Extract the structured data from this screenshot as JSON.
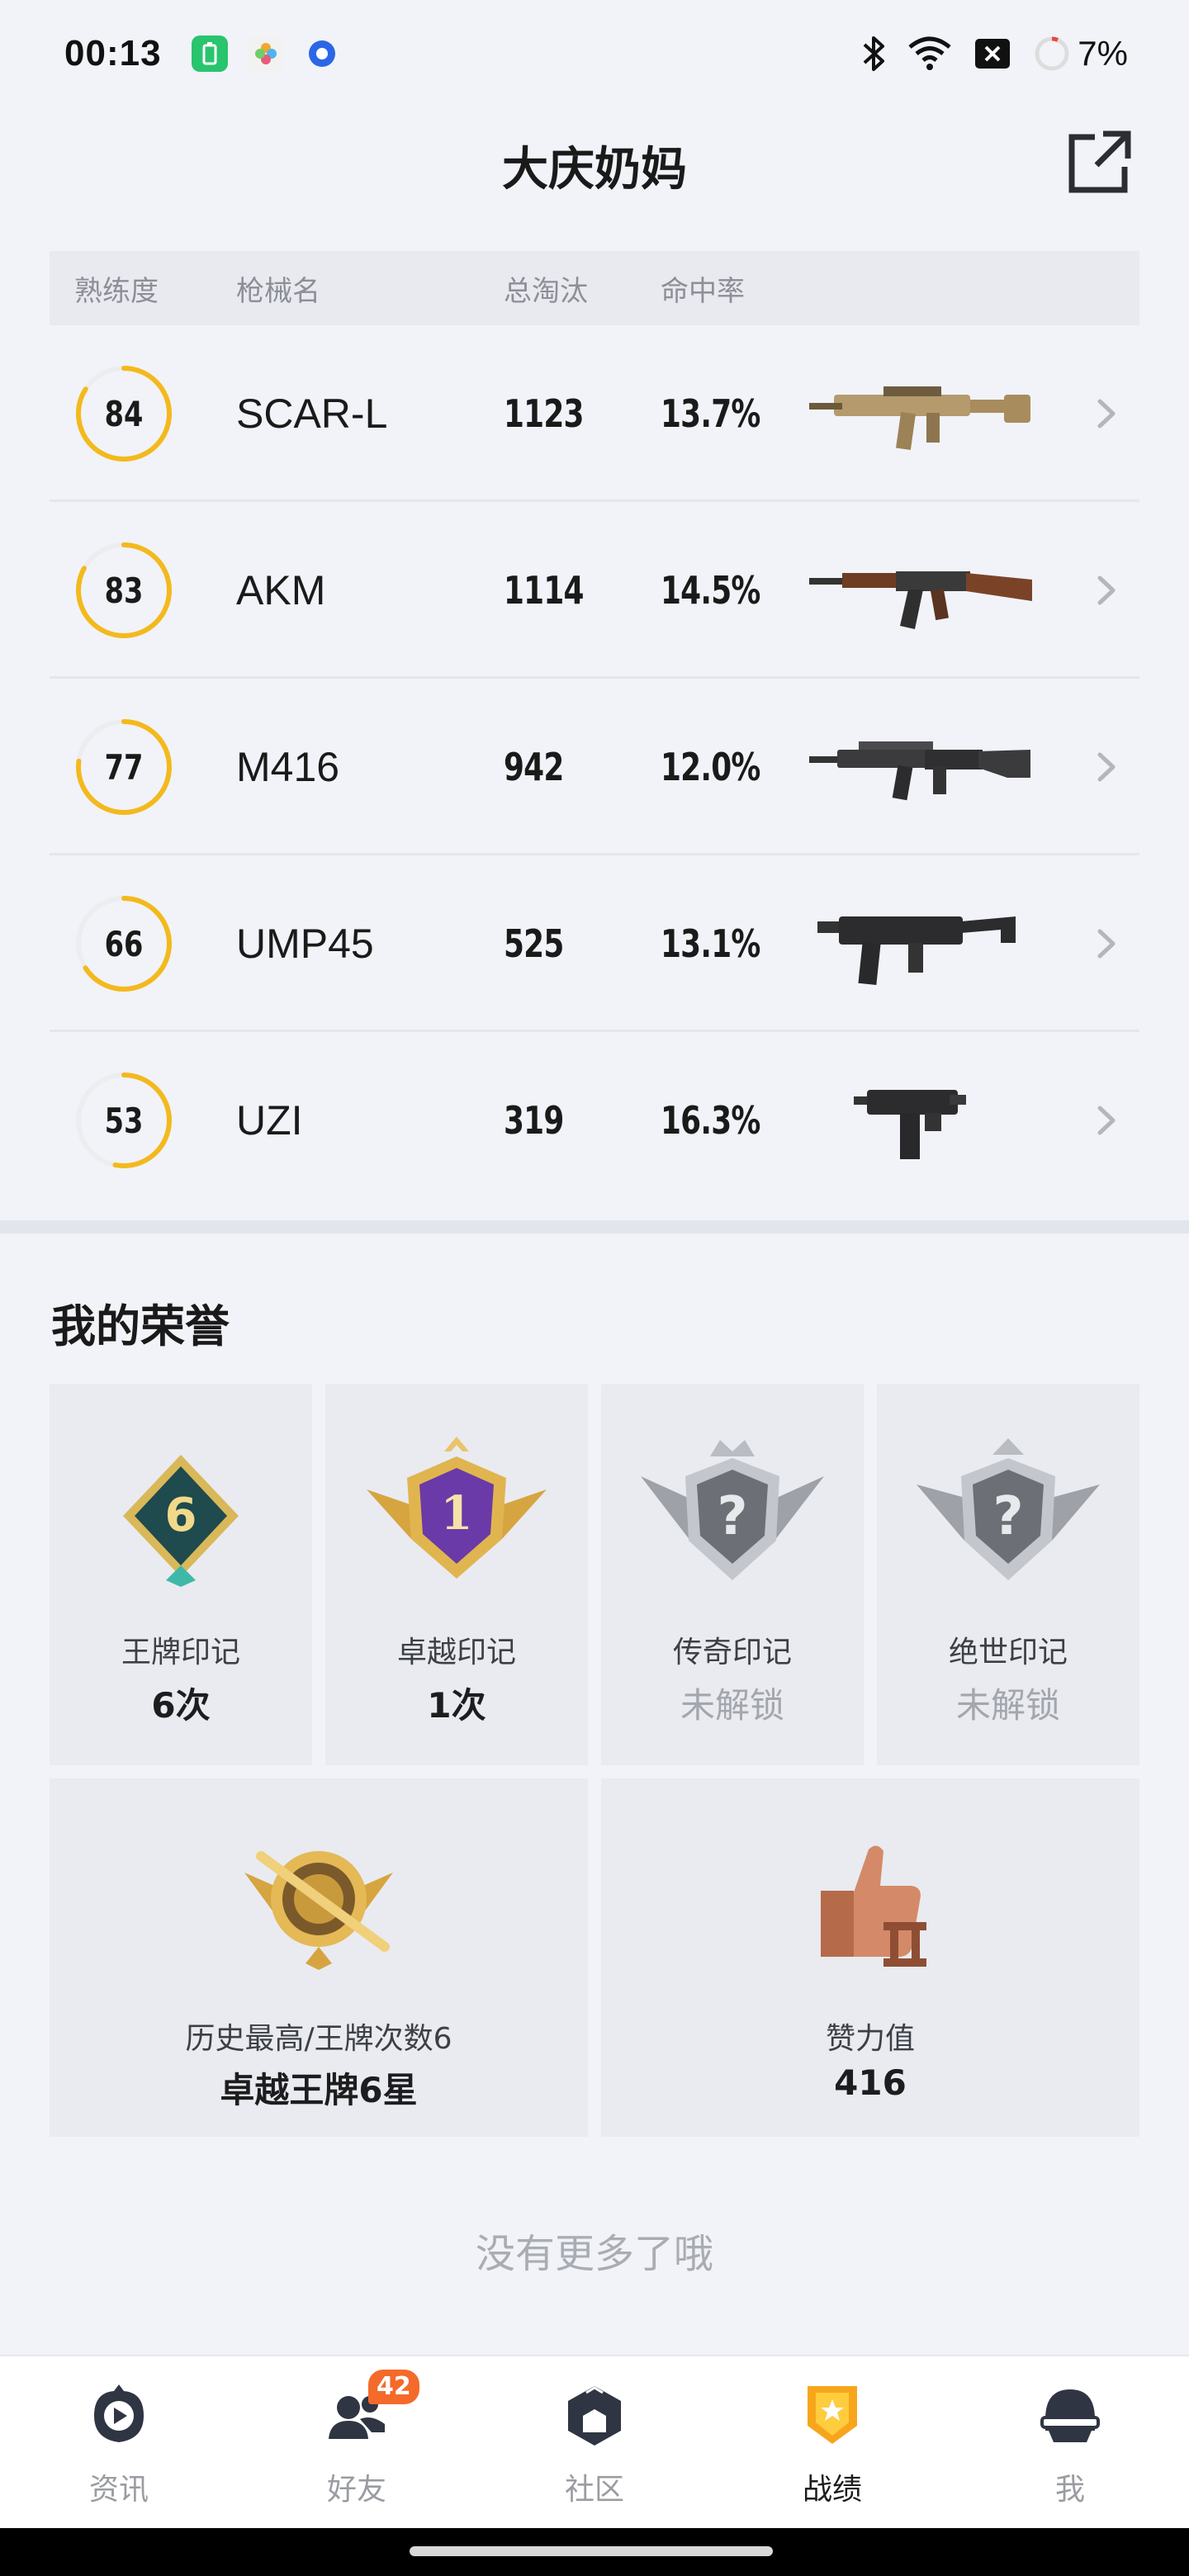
{
  "status_bar": {
    "time": "00:13",
    "battery": "7%",
    "icons": [
      "battery-app-icon",
      "flower-app-icon",
      "circle-app-icon",
      "bluetooth-icon",
      "wifi-icon",
      "x-box-icon",
      "battery-ring-icon"
    ]
  },
  "header": {
    "title": "大庆奶妈",
    "share_icon": "share-icon"
  },
  "weapons": {
    "columns": {
      "proficiency": "熟练度",
      "name": "枪械名",
      "kills": "总淘汰",
      "hit_rate": "命中率"
    },
    "rows": [
      {
        "proficiency": "84",
        "name": "SCAR-L",
        "kills": "1123",
        "hit_rate": "13.7%"
      },
      {
        "proficiency": "83",
        "name": "AKM",
        "kills": "1114",
        "hit_rate": "14.5%"
      },
      {
        "proficiency": "77",
        "name": "M416",
        "kills": "942",
        "hit_rate": "12.0%"
      },
      {
        "proficiency": "66",
        "name": "UMP45",
        "kills": "525",
        "hit_rate": "13.1%"
      },
      {
        "proficiency": "53",
        "name": "UZI",
        "kills": "319",
        "hit_rate": "16.3%"
      }
    ],
    "ring_color": "#f3b91d"
  },
  "honors": {
    "title": "我的荣誉",
    "cards": [
      {
        "label": "王牌印记",
        "value": "6次",
        "badge_number": "6",
        "locked": false
      },
      {
        "label": "卓越印记",
        "value": "1次",
        "badge_number": "1",
        "locked": false
      },
      {
        "label": "传奇印记",
        "value": "未解锁",
        "locked": true
      },
      {
        "label": "绝世印记",
        "value": "未解锁",
        "locked": true
      }
    ],
    "wide_cards": [
      {
        "label": "历史最高/王牌次数6",
        "value": "卓越王牌6星"
      },
      {
        "label": "赞力值",
        "value": "416"
      }
    ]
  },
  "footer_text": "没有更多了哦",
  "nav": {
    "items": [
      {
        "label": "资讯",
        "icon": "news-icon"
      },
      {
        "label": "好友",
        "icon": "friends-icon",
        "badge": "42"
      },
      {
        "label": "社区",
        "icon": "community-icon"
      },
      {
        "label": "战绩",
        "icon": "record-icon",
        "active": true
      },
      {
        "label": "我",
        "icon": "profile-icon"
      }
    ]
  }
}
